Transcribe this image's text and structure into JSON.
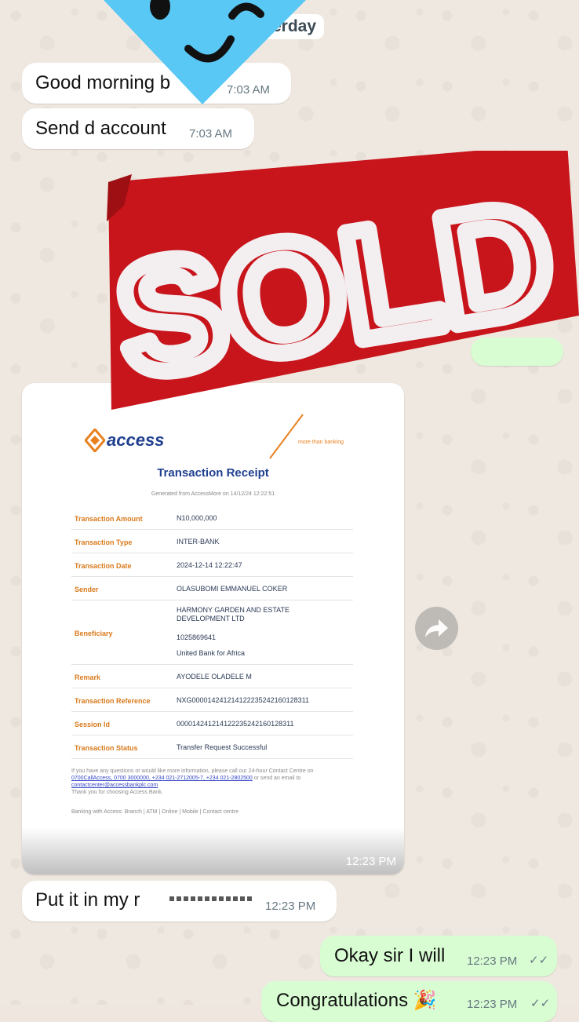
{
  "date_pill": "terday",
  "messages": [
    {
      "text": "Good morning b",
      "time": "7:03 AM"
    },
    {
      "text": "Send d account",
      "time": "7:03 AM"
    },
    {
      "text": "Put it in my r",
      "time": "12:23 PM"
    },
    {
      "text": "Okay sir I will",
      "time": "12:23 PM"
    },
    {
      "text": "Congratulations 🎉",
      "time": "12:23 PM"
    }
  ],
  "sticker": {
    "text": "SOLD"
  },
  "receipt": {
    "brand": "access",
    "tagline": "more than banking",
    "title": "Transaction Receipt",
    "generated": "Generated from AccessMore on 14/12/24 12:22:51",
    "rows": [
      {
        "label": "Transaction Amount",
        "value": "N10,000,000"
      },
      {
        "label": "Transaction Type",
        "value": "INTER-BANK"
      },
      {
        "label": "Transaction Date",
        "value": "2024-12-14 12:22:47"
      },
      {
        "label": "Sender",
        "value": "OLASUBOMI EMMANUEL COKER"
      },
      {
        "label": "Beneficiary",
        "value": "HARMONY GARDEN AND ESTATE DEVELOPMENT LTD",
        "value2": "1025869641",
        "value3": "United Bank for Africa"
      },
      {
        "label": "Remark",
        "value": "AYODELE OLADELE M"
      },
      {
        "label": "Transaction Reference",
        "value": "NXG000014241214122235242160128311"
      },
      {
        "label": "Session Id",
        "value": "000014241214122235242160128311"
      },
      {
        "label": "Transaction Status",
        "value": "Transfer Request Successful"
      }
    ],
    "footer_line1": "If you have any questions or would like more information, please call our 24-hour Contact Centre on",
    "footer_links": "0700CallAccess, 0700 3000000, +234 021-2712005-7, +234 021-2802500",
    "footer_mid": "or send an email to",
    "footer_email": "contactcenter@accessbankplc.com",
    "footer_thanks": "Thank you for choosing Access Bank.",
    "footer_banking": "Banking with Access: Branch | ATM | Online | Mobile | Contact centre",
    "time": "12:23 PM"
  },
  "colors": {
    "incoming": "#ffffff",
    "outgoing": "#d9fdd3",
    "sold_red": "#c8141b",
    "access_orange": "#e8811f",
    "access_blue": "#1f3f8f",
    "emoji_blue": "#5ac8f5"
  },
  "icons": [
    "forward-icon",
    "double-check-icon"
  ]
}
